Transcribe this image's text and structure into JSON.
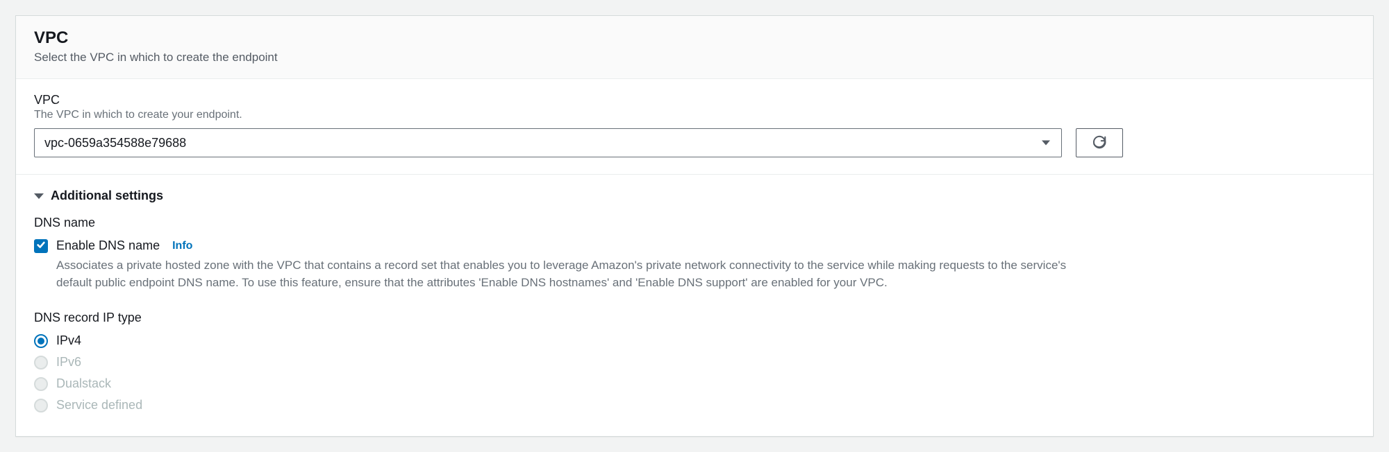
{
  "header": {
    "title": "VPC",
    "subtitle": "Select the VPC in which to create the endpoint"
  },
  "vpc_field": {
    "label": "VPC",
    "hint": "The VPC in which to create your endpoint.",
    "selected_value": "vpc-0659a354588e79688"
  },
  "additional": {
    "title": "Additional settings",
    "dns_name": {
      "heading": "DNS name",
      "checkbox_label": "Enable DNS name",
      "info": "Info",
      "description": "Associates a private hosted zone with the VPC that contains a record set that enables you to leverage Amazon's private network connectivity to the service while making requests to the service's default public endpoint DNS name. To use this feature, ensure that the attributes 'Enable DNS hostnames' and 'Enable DNS support' are enabled for your VPC."
    },
    "dns_record_type": {
      "heading": "DNS record IP type",
      "options": [
        {
          "label": "IPv4",
          "selected": true,
          "disabled": false
        },
        {
          "label": "IPv6",
          "selected": false,
          "disabled": true
        },
        {
          "label": "Dualstack",
          "selected": false,
          "disabled": true
        },
        {
          "label": "Service defined",
          "selected": false,
          "disabled": true
        }
      ]
    }
  }
}
